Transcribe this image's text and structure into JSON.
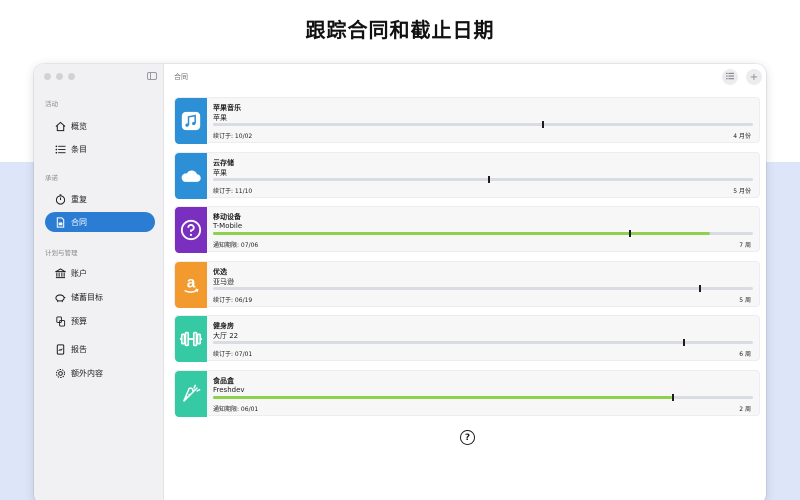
{
  "headline": "跟踪合同和截止日期",
  "sidebar": {
    "sections": [
      {
        "label": "活动",
        "items": [
          {
            "label": "概览",
            "icon": "home-icon"
          },
          {
            "label": "条目",
            "icon": "list-icon"
          }
        ]
      },
      {
        "label": "承诺",
        "items": [
          {
            "label": "重复",
            "icon": "timer-icon"
          },
          {
            "label": "合同",
            "icon": "document-icon",
            "active": true
          }
        ]
      },
      {
        "label": "计划与管理",
        "items": [
          {
            "label": "账户",
            "icon": "bank-icon"
          },
          {
            "label": "储蓄目标",
            "icon": "piggy-bank-icon"
          },
          {
            "label": "预算",
            "icon": "coins-icon"
          },
          {
            "label": "报告",
            "icon": "report-icon"
          },
          {
            "label": "额外内容",
            "icon": "gear-icon"
          }
        ]
      }
    ]
  },
  "main": {
    "title": "合同",
    "help_glyph": "?"
  },
  "contracts": [
    {
      "name": "苹果音乐",
      "vendor": "苹果",
      "date_label": "续订于: 10/02",
      "remaining": "4 月份",
      "progress": 0.0,
      "marker": 0.61,
      "icon": "music-note-icon",
      "color": "#2d8fd5"
    },
    {
      "name": "云存储",
      "vendor": "苹果",
      "date_label": "续订于: 11/10",
      "remaining": "5 月份",
      "progress": 0.0,
      "marker": 0.51,
      "icon": "cloud-icon",
      "color": "#2d8fd5"
    },
    {
      "name": "移动设备",
      "vendor": "T-Mobile",
      "date_label": "通知期限: 07/06",
      "remaining": "7 周",
      "progress": 0.92,
      "marker": 0.77,
      "icon": "question-circle-icon",
      "color": "#7b2fbf"
    },
    {
      "name": "优选",
      "vendor": "亚马逊",
      "date_label": "续订于: 06/19",
      "remaining": "5 周",
      "progress": 0.0,
      "marker": 0.9,
      "icon": "amazon-logo-icon",
      "color": "#f39a2e"
    },
    {
      "name": "健身房",
      "vendor": "大厅 22",
      "date_label": "续订于: 07/01",
      "remaining": "6 周",
      "progress": 0.0,
      "marker": 0.87,
      "icon": "dumbbell-icon",
      "color": "#35c9a4"
    },
    {
      "name": "食品盒",
      "vendor": "Freshdev",
      "date_label": "通知期限: 06/01",
      "remaining": "2 周",
      "progress": 0.85,
      "marker": 0.85,
      "icon": "carrot-icon",
      "color": "#35c9a4"
    }
  ]
}
